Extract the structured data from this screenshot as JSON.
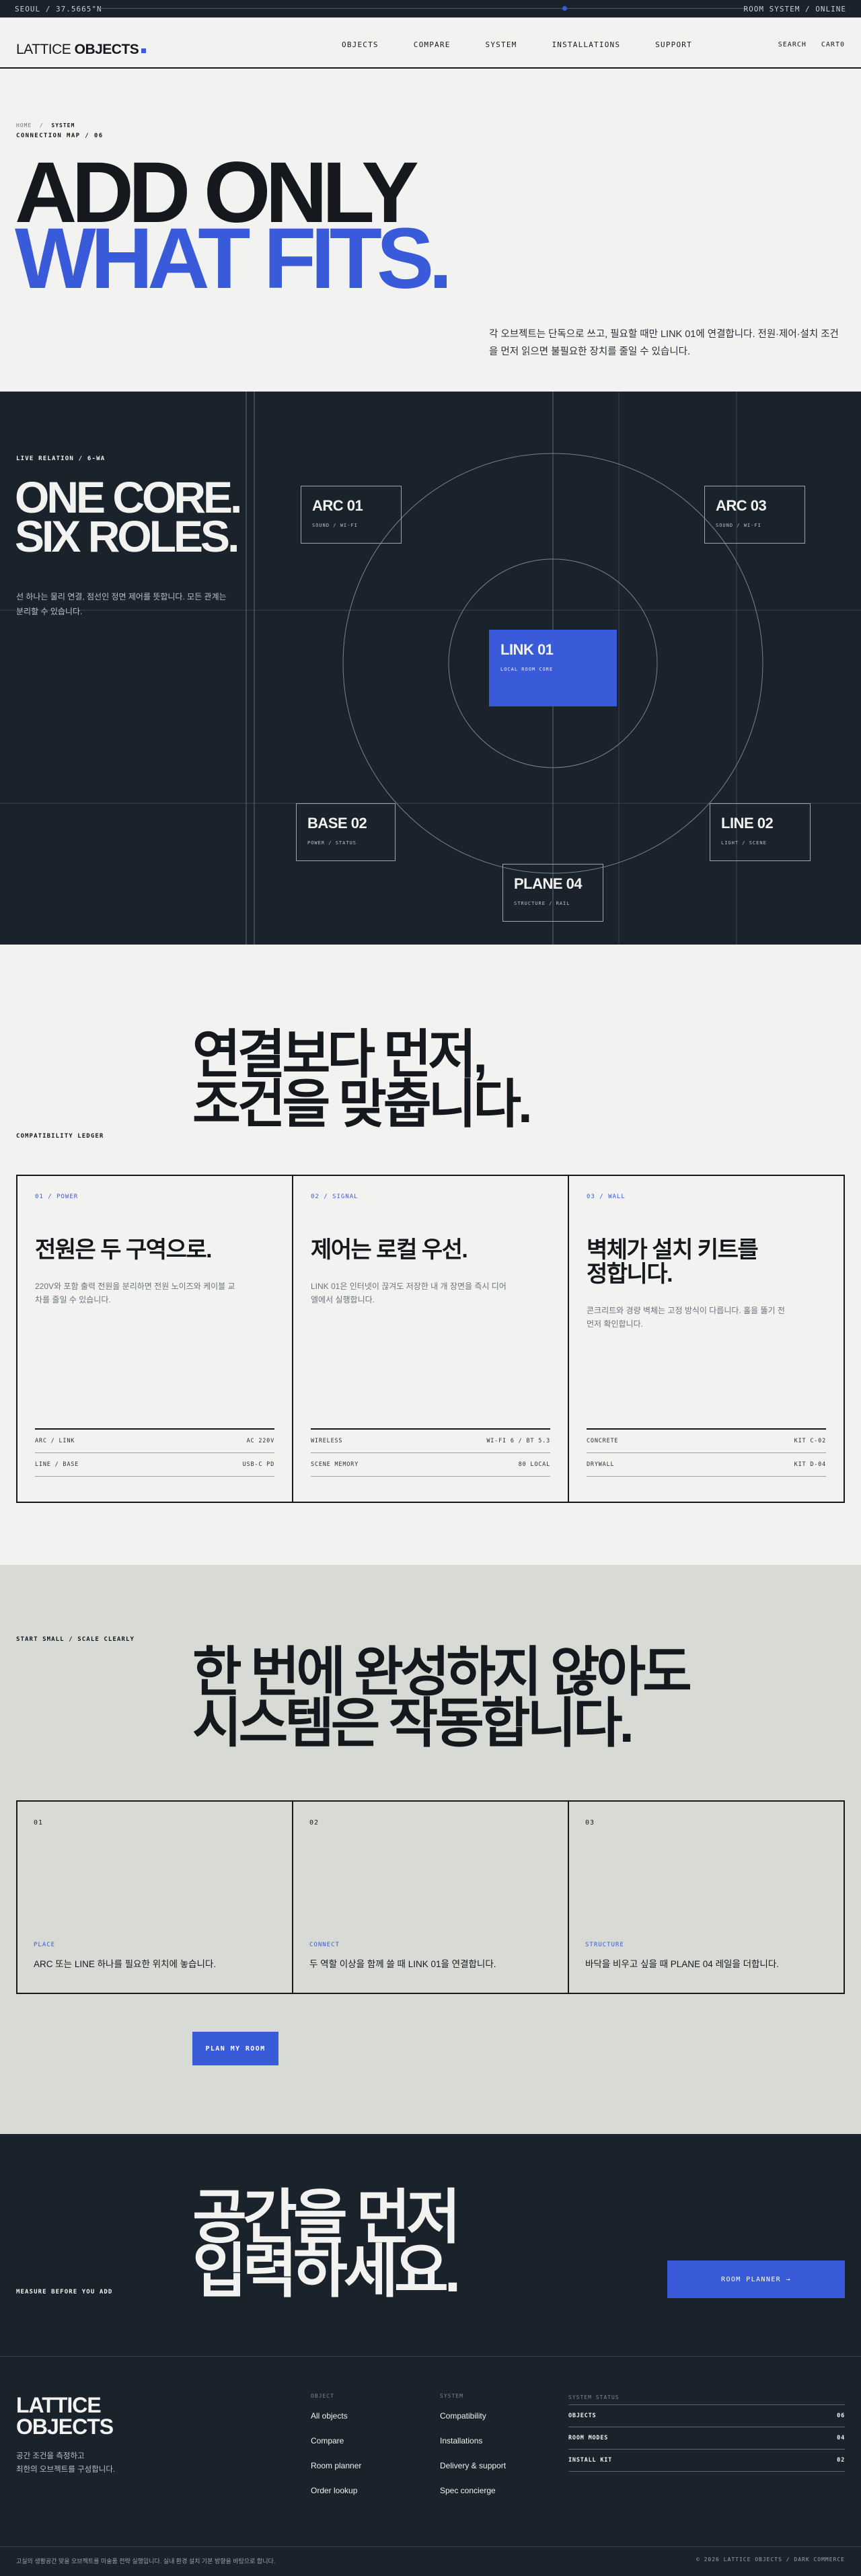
{
  "topbar": {
    "location": "SEOUL / 37.5665°N",
    "status": "ROOM SYSTEM / ONLINE"
  },
  "header": {
    "logo_light": "LATTICE ",
    "logo_bold": "OBJECTS",
    "nav": [
      "OBJECTS",
      "COMPARE",
      "SYSTEM",
      "INSTALLATIONS",
      "SUPPORT"
    ],
    "search": "SEARCH",
    "cart": "CART0"
  },
  "hero": {
    "crumb_home": "HOME",
    "crumb_sep": "/",
    "crumb_current": "SYSTEM",
    "subtitle": "CONNECTION MAP / 06",
    "title_line1": "ADD ONLY",
    "title_line2": "WHAT FITS.",
    "description": "각 오브젝트는 단독으로 쓰고, 필요할 때만 LINK 01에 연결합니다. 전원·제어·설치 조건을 먼저 읽으면 불필요한 장치를 줄일 수 있습니다."
  },
  "map": {
    "kicker": "LIVE RELATION / 6-WA",
    "title_line1": "ONE CORE.",
    "title_line2": "SIX ROLES.",
    "description": "선 하나는 물리 연결, 점선인 정면 제어를 뜻합니다. 모든 관계는 분리할 수 있습니다.",
    "nodes": [
      {
        "id": "arc01",
        "title": "ARC 01",
        "sub": "SOUND / WI-FI"
      },
      {
        "id": "arc03",
        "title": "ARC 03",
        "sub": "SOUND / WI-FI"
      },
      {
        "id": "link01",
        "title": "LINK 01",
        "sub": "LOCAL ROOM CORE",
        "active": true
      },
      {
        "id": "base02",
        "title": "BASE 02",
        "sub": "POWER / STATUS"
      },
      {
        "id": "line02",
        "title": "LINE 02",
        "sub": "LIGHT / SCENE"
      },
      {
        "id": "plane04",
        "title": "PLANE 04",
        "sub": "STRUCTURE / RAIL"
      }
    ]
  },
  "ledger": {
    "title_line1": "연결보다 먼저,",
    "title_line2": "조건을 맞춥니다.",
    "kicker": "COMPATIBILITY LEDGER",
    "cards": [
      {
        "tag": "01 / POWER",
        "title": "전원은 두 구역으로.",
        "text": "220V와 포함 출력 전원을 분리하면 전원 노이즈와 케이블 교차를 줄일 수 있습니다.",
        "rows": [
          [
            "ARC / LINK",
            "AC 220V"
          ],
          [
            "LINE / BASE",
            "USB-C PD"
          ]
        ]
      },
      {
        "tag": "02 / SIGNAL",
        "title": "제어는 로컬 우선.",
        "text": "LINK 01은 인터넷이 끊겨도 저장한 내 개 장면을 즉시 디어엘에서 실행합니다.",
        "rows": [
          [
            "WIRELESS",
            "WI-FI 6 / BT 5.3"
          ],
          [
            "SCENE MEMORY",
            "80 LOCAL"
          ]
        ]
      },
      {
        "tag": "03 / WALL",
        "title_line1": "벽체가 설치 키트를",
        "title_line2": "정합니다.",
        "text": "콘크리트와 경량 벽체는 고정 방식이 다릅니다. 홀을 뚫기 전 먼저 확인합니다.",
        "rows": [
          [
            "CONCRETE",
            "KIT C-02"
          ],
          [
            "DRYWALL",
            "KIT D-04"
          ]
        ]
      }
    ]
  },
  "small": {
    "kicker": "START SMALL / SCALE CLEARLY",
    "title_line1": "한 번에 완성하지 않아도",
    "title_line2": "시스템은 작동합니다.",
    "steps": [
      {
        "num": "01",
        "tag": "PLACE",
        "text": "ARC 또는 LINE 하나를 필요한 위치에 놓습니다."
      },
      {
        "num": "02",
        "tag": "CONNECT",
        "text": "두 역할 이상을 함께 쓸 때 LINK 01을 연결합니다."
      },
      {
        "num": "03",
        "tag": "STRUCTURE",
        "text": "바닥을 비우고 싶을 때 PLANE 04 레일을 더합니다."
      }
    ],
    "button": "PLAN MY ROOM"
  },
  "cta": {
    "kicker": "MEASURE BEFORE YOU ADD",
    "title_line1": "공간을 먼저",
    "title_line2": "입력하세요.",
    "button": "ROOM PLANNER →"
  },
  "footer": {
    "logo_line1": "LATTICE",
    "logo_line2": "OBJECTS",
    "desc_line1": "공간 조건을 측정하고",
    "desc_line2": "최한의 오브젝트를 구성합니다.",
    "col1_head": "OBJECT",
    "col1": [
      "All objects",
      "Compare",
      "Room planner",
      "Order lookup"
    ],
    "col2_head": "SYSTEM",
    "col2": [
      "Compatibility",
      "Installations",
      "Delivery & support",
      "Spec concierge"
    ],
    "status_head": "SYSTEM STATUS",
    "status_rows": [
      [
        "OBJECTS",
        "06"
      ],
      [
        "ROOM MODES",
        "04"
      ],
      [
        "INSTALL KIT",
        "02"
      ]
    ],
    "legal": "고실의 생활공간 맞을 오브젝트를 미술품 전략 실행입니다. 실내 환경 설치 기본 방향을 바탕으로 합니다.",
    "copyright": "© 2026 LATTICE OBJECTS / DARK COMMERCE"
  },
  "colors": {
    "accent": "#3a5bd9",
    "ink": "#15191e",
    "dark": "#1a222b",
    "paper": "#f2f2f0",
    "stone": "#d8dad6"
  }
}
